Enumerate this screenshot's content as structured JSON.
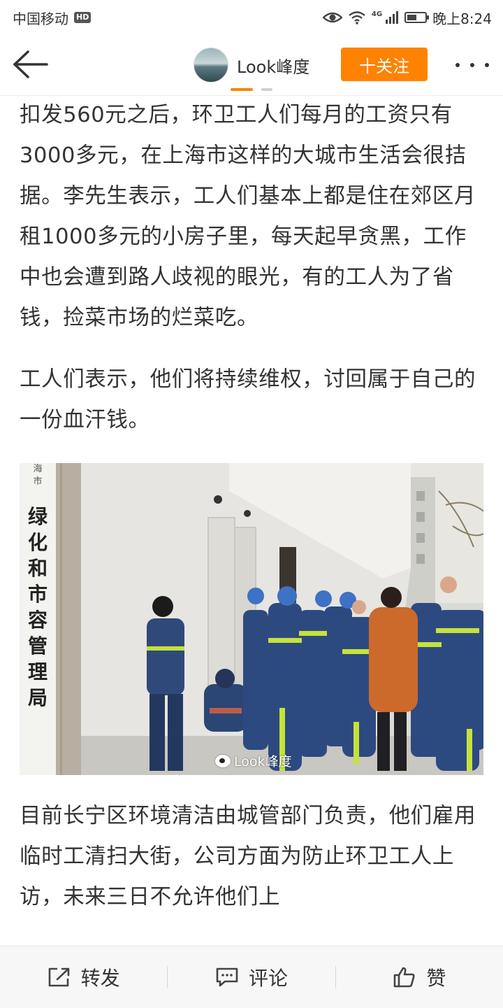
{
  "status_bar": {
    "carrier": "中国移动",
    "hd_badge": "HD",
    "network_tag": "4G",
    "time": "晚上8:24",
    "battery_level": 0.55
  },
  "nav": {
    "back_icon": "arrow-left-icon",
    "account_name": "Look峰度",
    "follow_label": "十关注",
    "more_icon": "more-dots-icon",
    "accent_color": "#ff8200"
  },
  "article": {
    "paragraphs": [
      "扣发560元之后，环卫工人们每月的工资只有3000多元，在上海市这样的大城市生活会很拮据。李先生表示，工人们基本上都是住在郊区月租1000多元的小房子里，每天起早贪黑，工作中也会遭到路人歧视的眼光，有的工人为了省钱，捡菜市场的烂菜吃。",
      "工人们表示，他们将持续维权，讨回属于自己的一份血汗钱。",
      "目前长宁区环境清洁由城管部门负责，他们雇用临时工清扫大街，公司方面为防止环卫工人上访，未来三日不允许他们上"
    ],
    "photo": {
      "sign_small": [
        "海",
        "市"
      ],
      "sign_big": [
        "绿",
        "化",
        "和",
        "市",
        "容",
        "管",
        "理",
        "局"
      ],
      "watermark": "Look峰度"
    }
  },
  "bottom_bar": {
    "items": [
      {
        "label": "转发",
        "icon": "share-icon"
      },
      {
        "label": "评论",
        "icon": "comment-icon"
      },
      {
        "label": "赞",
        "icon": "thumbs-up-icon"
      }
    ]
  }
}
